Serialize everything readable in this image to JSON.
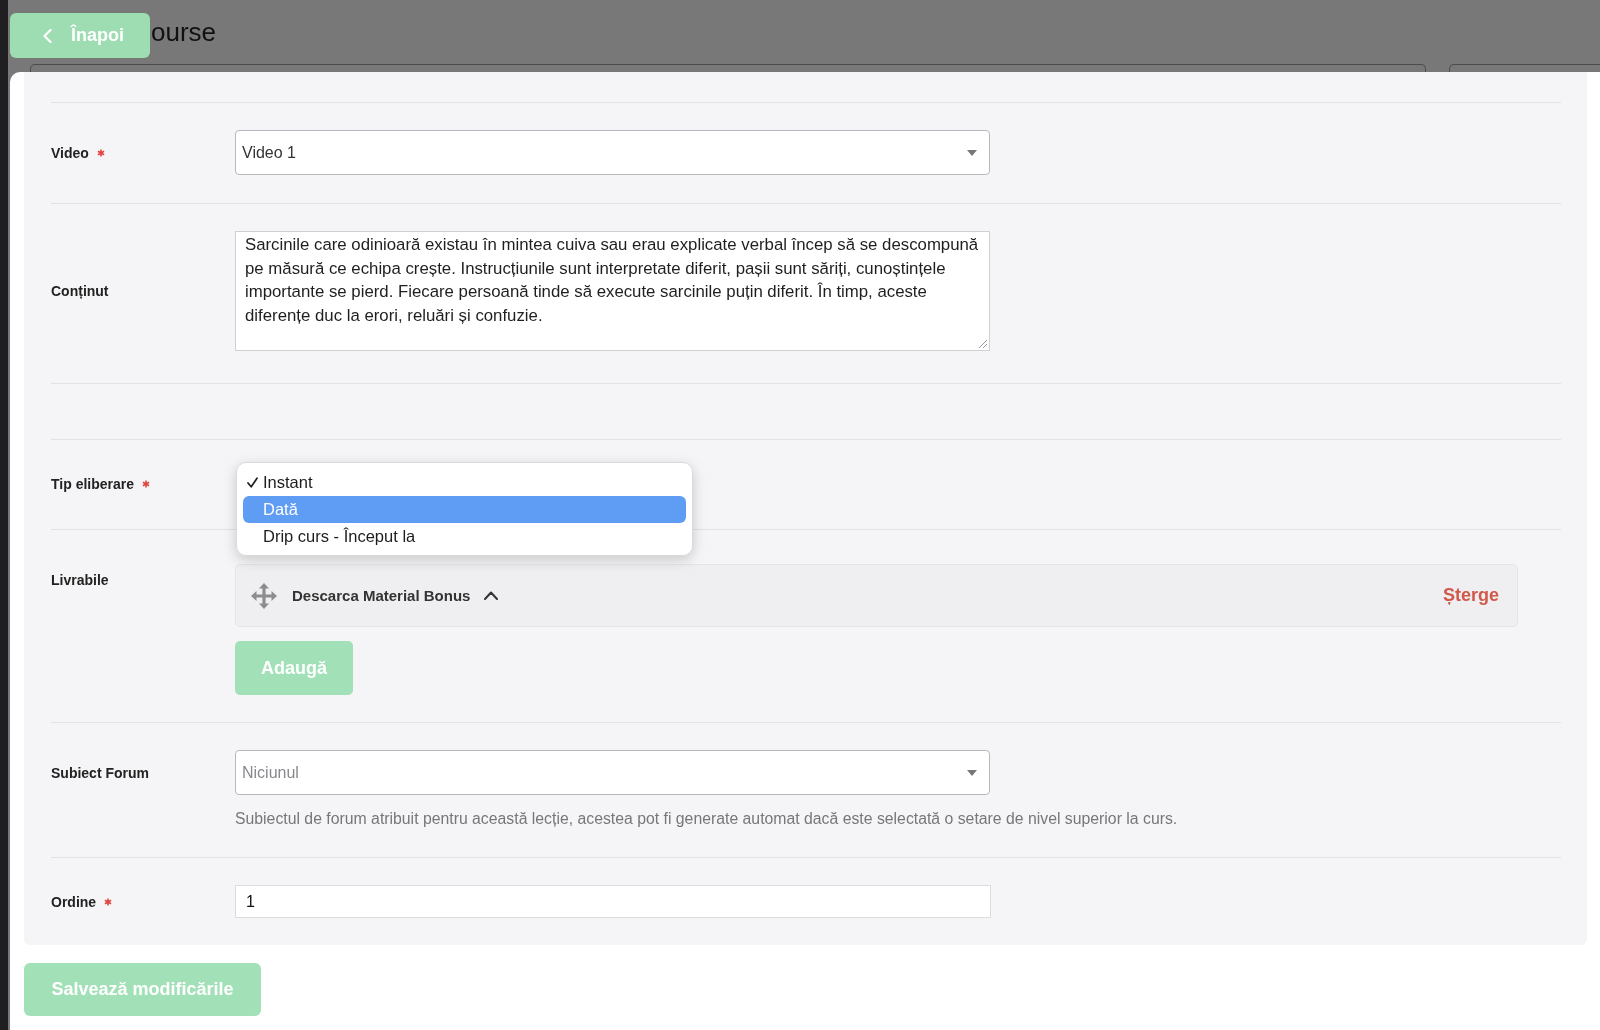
{
  "header": {
    "back_button": "Înapoi",
    "title": "ourse"
  },
  "form": {
    "fields": [
      {
        "kind": "select",
        "label": "Video",
        "required": true,
        "value": "Video 1"
      },
      {
        "kind": "textarea",
        "label": "Conținut",
        "required": false,
        "value": "Sarcinile care odinioară existau în mintea cuiva sau erau explicate verbal încep să se descompună pe măsură ce echipa crește. Instrucțiunile sunt interpretate diferit, pașii sunt săriți, cunoștințele importante se pierd. Fiecare persoană tinde să execute sarcinile puțin diferit. În timp, aceste diferențe duc la erori, reluări și confuzie."
      },
      {
        "kind": "dropdown",
        "label": "Tip eliberare",
        "required": true,
        "options": [
          {
            "label": "Instant",
            "selected": true,
            "highlighted": false
          },
          {
            "label": "Dată",
            "selected": false,
            "highlighted": true
          },
          {
            "label": "Drip curs - Început la",
            "selected": false,
            "highlighted": false
          }
        ]
      },
      {
        "kind": "repeater",
        "label": "Livrabile",
        "required": false,
        "items": [
          {
            "title": "Descarca Material Bonus",
            "delete_link": "Șterge"
          }
        ],
        "add_button": "Adaugă"
      },
      {
        "kind": "select",
        "label": "Subiect Forum",
        "required": false,
        "placeholder": "Niciunul",
        "help": "Subiectul de forum atribuit pentru această lecție, acestea pot fi generate automat dacă este selectată o setare de nivel superior la curs."
      },
      {
        "kind": "input",
        "label": "Ordine",
        "required": true,
        "value": "1"
      }
    ]
  },
  "footer": {
    "save_button": "Salvează modificările"
  }
}
